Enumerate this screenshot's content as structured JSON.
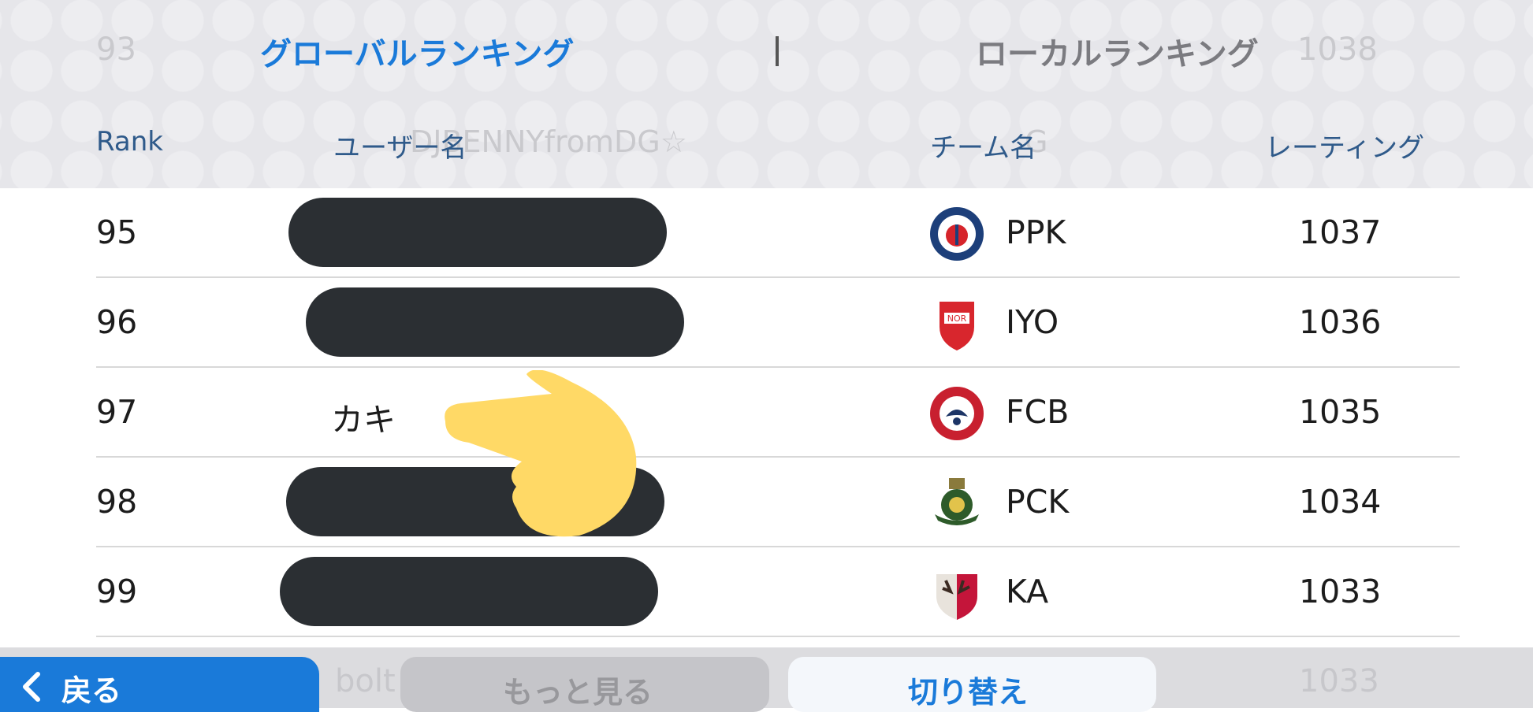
{
  "tabs": {
    "global": "グローバルランキング",
    "local": "ローカルランキング"
  },
  "columns": {
    "rank": "Rank",
    "user": "ユーザー名",
    "team": "チーム名",
    "rating": "レーティング"
  },
  "ghost": {
    "rank93": "93",
    "rating93": "1038",
    "user94": "DJBENNYfromDG☆",
    "team94": "G",
    "user100": "bolt",
    "rating100": "1033"
  },
  "rows": [
    {
      "rank": "95",
      "user": "",
      "team": "PPK",
      "rating": "1037",
      "crest": "psg-crest-icon"
    },
    {
      "rank": "96",
      "user": "",
      "team": "IYO",
      "rating": "1036",
      "crest": "nor-crest-icon"
    },
    {
      "rank": "97",
      "user": "カキ",
      "team": "FCB",
      "rating": "1035",
      "crest": "fontana-crest-icon"
    },
    {
      "rank": "98",
      "user": "",
      "team": "PCK",
      "rating": "1034",
      "crest": "pck-crest-icon"
    },
    {
      "rank": "99",
      "user": "",
      "team": "KA",
      "rating": "1033",
      "crest": "kashima-crest-icon"
    }
  ],
  "buttons": {
    "back": "戻る",
    "more": "もっと見る",
    "switch": "切り替え"
  },
  "colors": {
    "accent": "#1a7ad9",
    "redaction": "#2b2f33",
    "hand": "#ffd966"
  }
}
